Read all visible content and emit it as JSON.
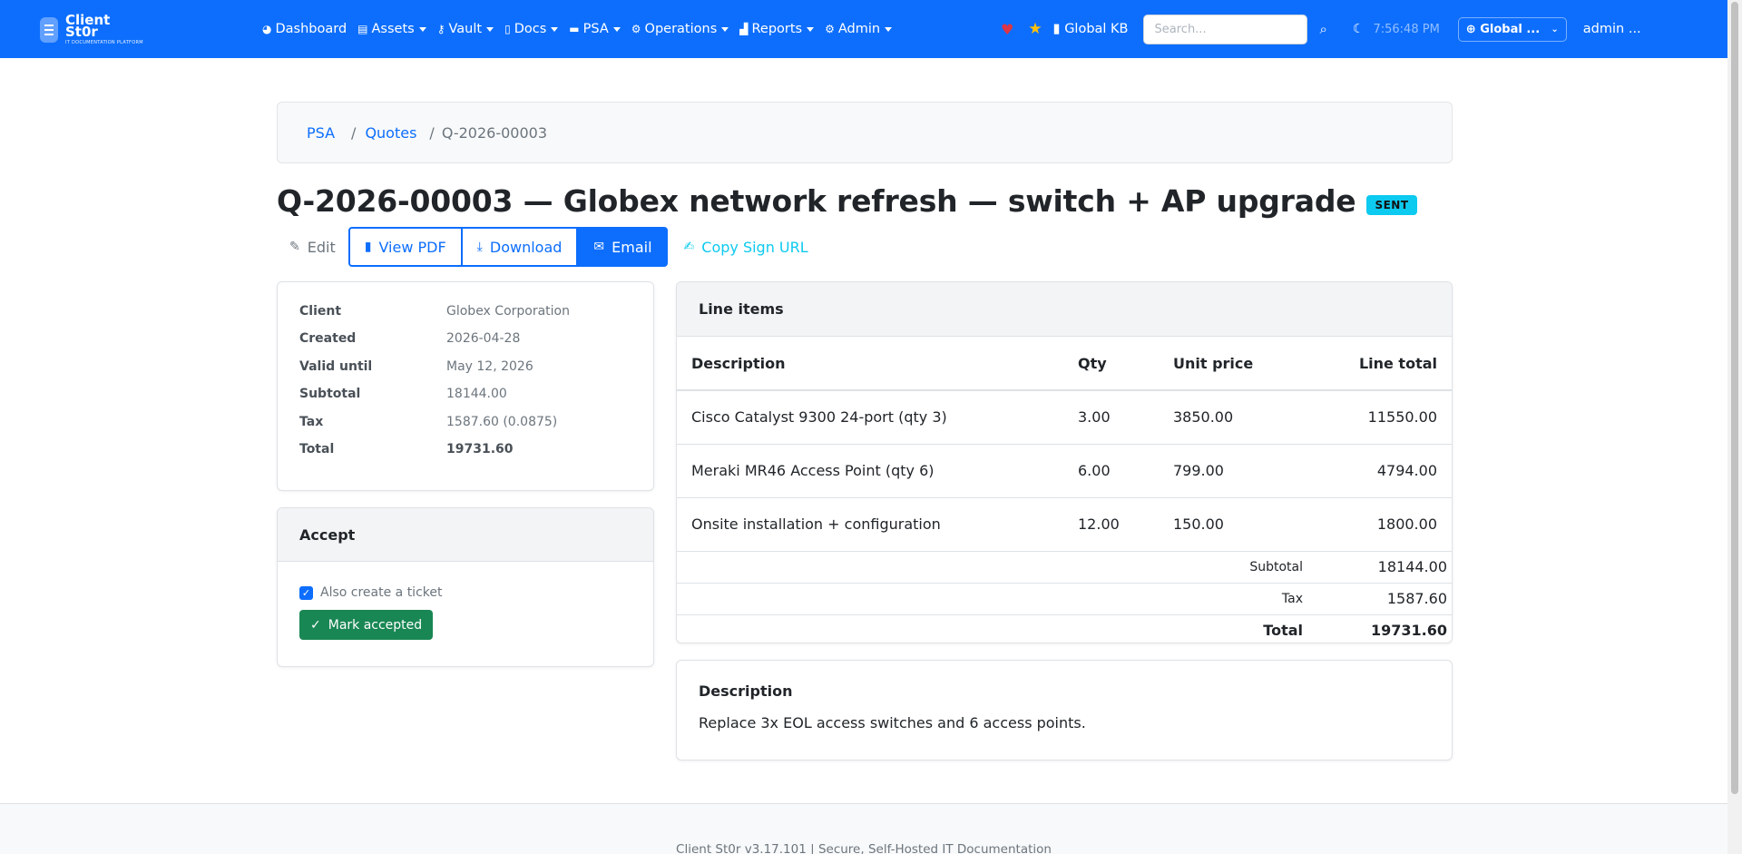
{
  "brand": {
    "name_line1": "Client",
    "name_line2": "St0r",
    "tagline": "IT DOCUMENTATION PLATFORM"
  },
  "nav": {
    "items": [
      {
        "label": "Dashboard",
        "icon": "dashboard-icon",
        "dropdown": false
      },
      {
        "label": "Assets",
        "icon": "assets-icon",
        "dropdown": true
      },
      {
        "label": "Vault",
        "icon": "key-icon",
        "dropdown": true
      },
      {
        "label": "Docs",
        "icon": "doc-icon",
        "dropdown": true
      },
      {
        "label": "PSA",
        "icon": "ticket-icon",
        "dropdown": true
      },
      {
        "label": "Operations",
        "icon": "gears-icon",
        "dropdown": true
      },
      {
        "label": "Reports",
        "icon": "chart-icon",
        "dropdown": true
      },
      {
        "label": "Admin",
        "icon": "gear-icon",
        "dropdown": true
      }
    ],
    "global_kb": "Global KB",
    "search_placeholder": "Search...",
    "time": "7:56:48 PM",
    "scope": "Global ...",
    "user": "admin ..."
  },
  "breadcrumb": {
    "items": [
      "PSA",
      "Quotes"
    ],
    "current": "Q-2026-00003"
  },
  "quote": {
    "title": "Q-2026-00003 — Globex network refresh — switch + AP upgrade",
    "status": "SENT"
  },
  "actions": {
    "edit": "Edit",
    "view_pdf": "View PDF",
    "download": "Download",
    "email": "Email",
    "copy_sign_url": "Copy Sign URL"
  },
  "info": [
    {
      "label": "Client",
      "value": "Globex Corporation"
    },
    {
      "label": "Created",
      "value": "2026-04-28"
    },
    {
      "label": "Valid until",
      "value": "May 12, 2026"
    },
    {
      "label": "Subtotal",
      "value": "18144.00"
    },
    {
      "label": "Tax",
      "value": "1587.60 (0.0875)"
    },
    {
      "label": "Total",
      "value": "19731.60"
    }
  ],
  "accept": {
    "title": "Accept",
    "checkbox_label": "Also create a ticket",
    "checked": true,
    "button": "Mark accepted"
  },
  "line_items": {
    "title": "Line items",
    "columns": [
      "Description",
      "Qty",
      "Unit price",
      "Line total"
    ],
    "rows": [
      {
        "description": "Cisco Catalyst 9300 24-port (qty 3)",
        "qty": "3.00",
        "unit_price": "3850.00",
        "line_total": "11550.00"
      },
      {
        "description": "Meraki MR46 Access Point (qty 6)",
        "qty": "6.00",
        "unit_price": "799.00",
        "line_total": "4794.00"
      },
      {
        "description": "Onsite installation + configuration",
        "qty": "12.00",
        "unit_price": "150.00",
        "line_total": "1800.00"
      }
    ],
    "subtotal_label": "Subtotal",
    "subtotal": "18144.00",
    "tax_label": "Tax",
    "tax": "1587.60",
    "total_label": "Total",
    "total": "19731.60"
  },
  "description": {
    "title": "Description",
    "text": "Replace 3x EOL access switches and 6 access points."
  },
  "footer": {
    "text": "Client St0r v3.17.101 | Secure, Self-Hosted IT Documentation"
  },
  "colors": {
    "primary": "#0d6efd",
    "success": "#198754",
    "info": "#0dcaf0",
    "danger": "#dc3545",
    "warning": "#ffc107"
  }
}
